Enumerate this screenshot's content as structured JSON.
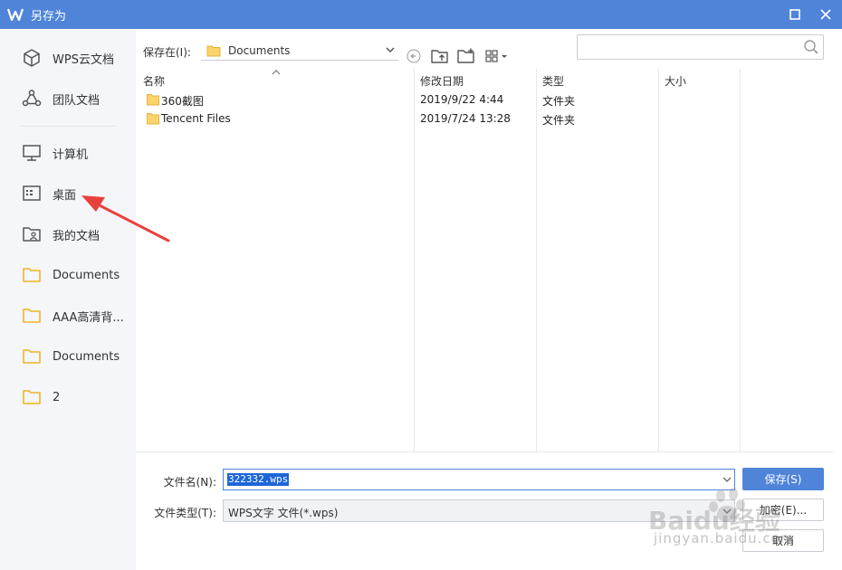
{
  "window": {
    "title": "另存为",
    "accent_color": "#4f84d9",
    "logo_icon": "wps-w-logo-icon",
    "maximize_icon": "maximize-icon",
    "close_icon": "close-icon"
  },
  "sidebar": {
    "items": [
      {
        "label": "WPS云文档",
        "icon": "cloud-box-icon"
      },
      {
        "label": "团队文档",
        "icon": "team-icon"
      },
      {
        "label": "计算机",
        "icon": "monitor-icon"
      },
      {
        "label": "桌面",
        "icon": "desktop-icon"
      },
      {
        "label": "我的文档",
        "icon": "user-folder-icon"
      },
      {
        "label": "Documents",
        "icon": "folder-icon"
      },
      {
        "label": "AAA高清背...",
        "icon": "folder-icon"
      },
      {
        "label": "Documents",
        "icon": "folder-icon"
      },
      {
        "label": "2",
        "icon": "folder-icon"
      }
    ]
  },
  "toolbar": {
    "save_in_label": "保存在(I):",
    "current_path": "Documents",
    "search_placeholder": ""
  },
  "file_list": {
    "columns": [
      "名称",
      "修改日期",
      "类型",
      "大小"
    ],
    "rows": [
      {
        "name": "360截图",
        "modified": "2019/9/22 4:44",
        "type": "文件夹",
        "size": ""
      },
      {
        "name": "Tencent Files",
        "modified": "2019/7/24 13:28",
        "type": "文件夹",
        "size": ""
      }
    ]
  },
  "form": {
    "filename_label": "文件名(N):",
    "filename_value": "322332.wps",
    "filetype_label": "文件类型(T):",
    "filetype_value": "WPS文字 文件(*.wps)"
  },
  "buttons": {
    "save": "保存(S)",
    "encrypt": "加密(E)...",
    "cancel": "取消"
  },
  "watermark": {
    "brand": "Baidu经验",
    "url": "jingyan.baidu.com"
  }
}
